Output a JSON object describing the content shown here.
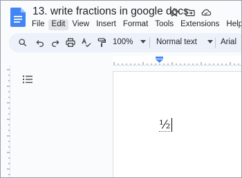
{
  "document": {
    "title": "13. write fractions in google docs",
    "body_text": "½"
  },
  "menubar": {
    "items": [
      {
        "label": "File",
        "active": false
      },
      {
        "label": "Edit",
        "active": true
      },
      {
        "label": "View",
        "active": false
      },
      {
        "label": "Insert",
        "active": false
      },
      {
        "label": "Format",
        "active": false
      },
      {
        "label": "Tools",
        "active": false
      },
      {
        "label": "Extensions",
        "active": false
      },
      {
        "label": "Help",
        "active": false
      }
    ]
  },
  "toolbar": {
    "icons": [
      "search-icon",
      "undo-icon",
      "redo-icon",
      "print-icon",
      "spellcheck-icon",
      "paint-format-icon"
    ],
    "zoom": "100%",
    "paragraph_style": "Normal text",
    "font": "Arial"
  },
  "colors": {
    "app_background": "#f9fbfd",
    "toolbar_background": "#edf2fa",
    "docs_blue": "#4285f4",
    "ruler_marker": "#4285f4",
    "active_menu": "#e2e6ea"
  }
}
